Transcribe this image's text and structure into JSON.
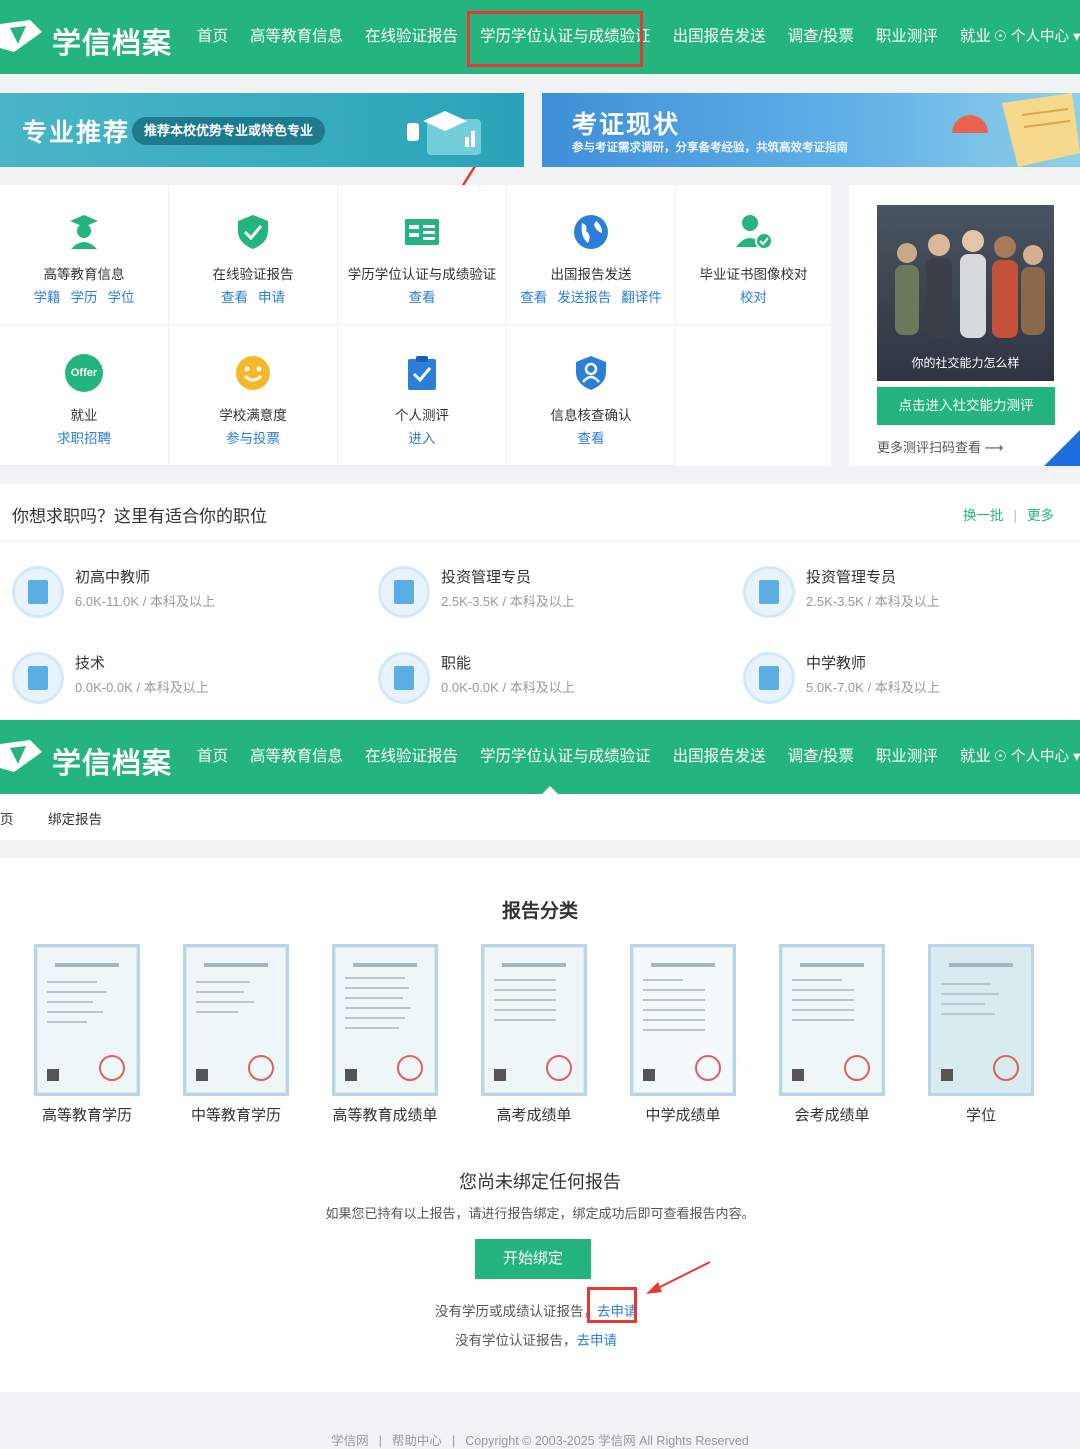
{
  "nav": {
    "logo_text": "学信档案",
    "menu": [
      "首页",
      "高等教育信息",
      "在线验证报告",
      "学历学位认证与成绩验证",
      "出国报告发送",
      "调查/投票",
      "职业测评",
      "就业"
    ],
    "user": "个人中心"
  },
  "banners": {
    "left": {
      "title": "专业推荐",
      "pill": "推荐本校优势专业或特色专业"
    },
    "right": {
      "title": "考证现状",
      "subtitle": "参与考证需求调研，分享备考经验，共筑高效考证指南"
    }
  },
  "services": [
    {
      "name": "高等教育信息",
      "links": [
        "学籍",
        "学历",
        "学位"
      ],
      "icon": "graduate-icon"
    },
    {
      "name": "在线验证报告",
      "links": [
        "查看",
        "申请"
      ],
      "icon": "shield-check-icon"
    },
    {
      "name": "学历学位认证与成绩验证",
      "links": [
        "查看"
      ],
      "icon": "id-card-icon"
    },
    {
      "name": "出国报告发送",
      "links": [
        "查看",
        "发送报告",
        "翻译件"
      ],
      "icon": "globe-icon"
    },
    {
      "name": "毕业证书图像校对",
      "links": [
        "校对"
      ],
      "icon": "user-check-icon"
    },
    {
      "name": "就业",
      "links": [
        "求职招聘"
      ],
      "icon": "offer-icon"
    },
    {
      "name": "学校满意度",
      "links": [
        "参与投票"
      ],
      "icon": "smile-icon"
    },
    {
      "name": "个人测评",
      "links": [
        "进入"
      ],
      "icon": "clipboard-check-icon"
    },
    {
      "name": "信息核查确认",
      "links": [
        "查看"
      ],
      "icon": "shield-user-icon"
    }
  ],
  "offer_badge": "Offer",
  "promo": {
    "caption": "你的社交能力怎么样",
    "cta": "点击进入社交能力测评",
    "more": "更多测评扫码查看"
  },
  "jobs": {
    "heading": "你想求职吗？这里有适合你的职位",
    "refresh": "换一批",
    "more": "更多",
    "separator": "|",
    "items": [
      {
        "title": "初高中教师",
        "salary": "6.0K-11.0K",
        "edu": "本科及以上"
      },
      {
        "title": "投资管理专员",
        "salary": "2.5K-3.5K",
        "edu": "本科及以上"
      },
      {
        "title": "投资管理专员",
        "salary": "2.5K-3.5K",
        "edu": "本科及以上"
      },
      {
        "title": "技术",
        "salary": "0.0K-0.0K",
        "edu": "本科及以上"
      },
      {
        "title": "职能",
        "salary": "0.0K-0.0K",
        "edu": "本科及以上"
      },
      {
        "title": "中学教师",
        "salary": "5.0K-7.0K",
        "edu": "本科及以上"
      }
    ],
    "meta_sep": "/"
  },
  "breadcrumb": {
    "home": "页",
    "current": "绑定报告"
  },
  "report": {
    "title": "报告分类",
    "categories": [
      "高等教育学历",
      "中等教育学历",
      "高等教育成绩单",
      "高考成绩单",
      "中学成绩单",
      "会考成绩单",
      "学位"
    ],
    "empty_title": "您尚未绑定任何报告",
    "empty_desc": "如果您已持有以上报告，请进行报告绑定，绑定成功后即可查看报告内容。",
    "bind_button": "开始绑定",
    "line1_text": "没有学历或成绩认证报告，",
    "line1_link": "去申请",
    "line2_text": "没有学位认证报告，",
    "line2_link": "去申请"
  },
  "footer": {
    "items": [
      "学信网",
      "帮助中心",
      "Copyright © 2003-2025 学信网 All Rights Reserved"
    ],
    "sep": "|"
  },
  "colors": {
    "brand": "#24b47e",
    "link": "#2b7fd6",
    "annotation": "#e53935"
  }
}
